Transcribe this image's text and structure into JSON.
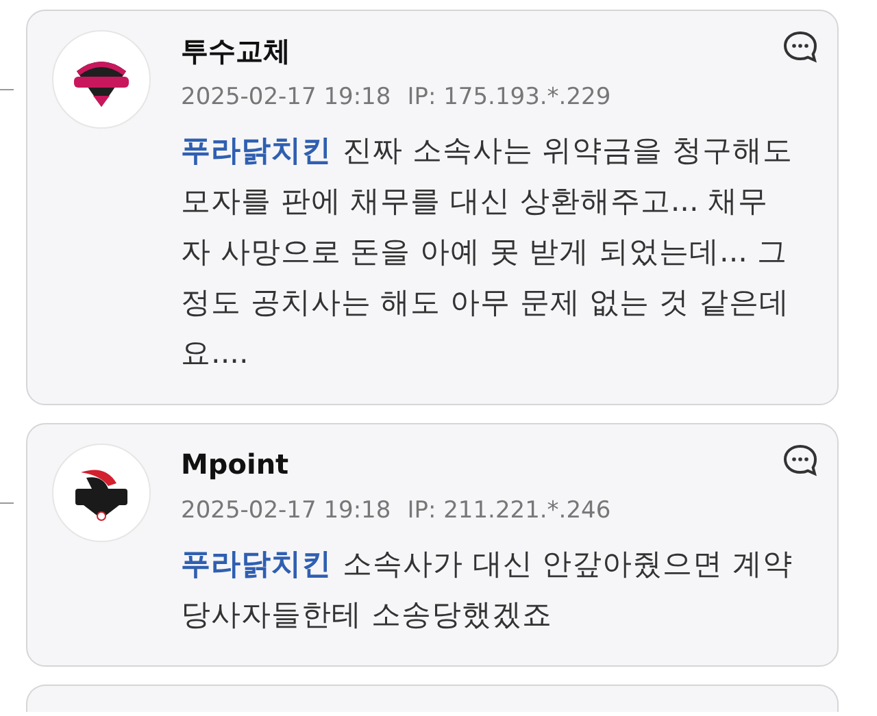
{
  "comments": [
    {
      "author": "투수교체",
      "timestamp": "2025-02-17 19:18",
      "ip": "IP: 175.193.*.229",
      "mention": "푸라닭치킨",
      "text": "진짜 소속사는 위약금을 청구해도 모자를 판에 채무를 대신 상환해주고... 채무자 사망으로 돈을 아예 못 받게 되었는데... 그 정도 공치사는 해도 아무 문제 없는 것 같은데요...."
    },
    {
      "author": "Mpoint",
      "timestamp": "2025-02-17 19:18",
      "ip": "IP: 211.221.*.246",
      "mention": "푸라닭치킨",
      "text": "소속사가 대신 안갚아줬으면 계약당사자들한테 소송당했겠죠"
    }
  ]
}
